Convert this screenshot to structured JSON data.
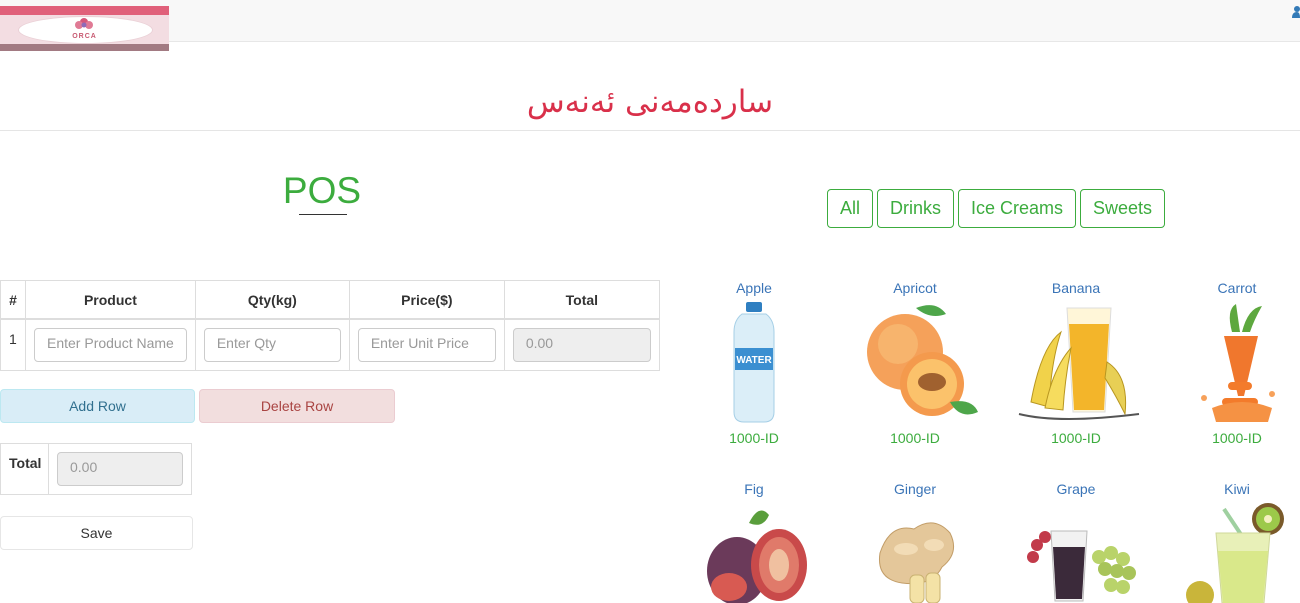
{
  "header": {
    "logo_text": "ORCA",
    "store_title": "ساردەمەنی ئەنەس"
  },
  "pos": {
    "title": "POS",
    "columns": [
      "#",
      "Product",
      "Qty(kg)",
      "Price($)",
      "Total"
    ],
    "row": {
      "number": "1",
      "product_placeholder": "Enter Product Name",
      "qty_placeholder": "Enter Qty",
      "price_placeholder": "Enter Unit Price",
      "total_value": "0.00"
    },
    "add_row_label": "Add Row",
    "delete_row_label": "Delete Row",
    "total_label": "Total",
    "grand_total_value": "0.00",
    "save_label": "Save"
  },
  "categories": [
    "All",
    "Drinks",
    "Ice Creams",
    "Sweets"
  ],
  "products": [
    {
      "name": "Apple",
      "price": "1000-ID",
      "image": "water-bottle-image"
    },
    {
      "name": "Apricot",
      "price": "1000-ID",
      "image": "apricot-image"
    },
    {
      "name": "Banana",
      "price": "1000-ID",
      "image": "banana-juice-image"
    },
    {
      "name": "Carrot",
      "price": "1000-ID",
      "image": "carrot-juice-image"
    },
    {
      "name": "Fig",
      "image": "fig-image"
    },
    {
      "name": "Ginger",
      "image": "ginger-image"
    },
    {
      "name": "Grape",
      "image": "grape-juice-image"
    },
    {
      "name": "Kiwi",
      "image": "kiwi-juice-image"
    }
  ],
  "colors": {
    "accent_green": "#3cac3e",
    "title_red": "#d9304a",
    "link_blue": "#3a74b7"
  },
  "icons": [
    "user-icon",
    "logo-flower-icon"
  ]
}
